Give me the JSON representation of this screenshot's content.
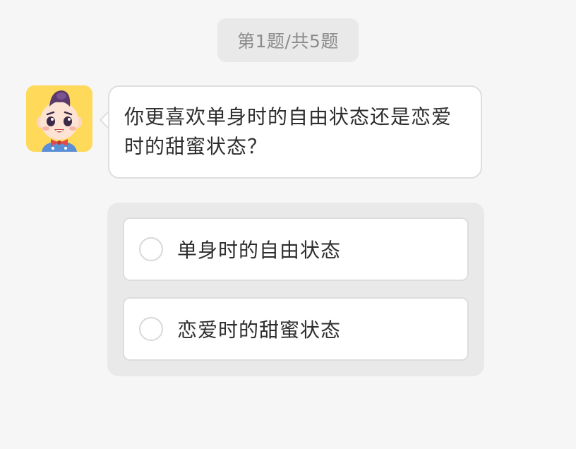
{
  "progress": {
    "text": "第1题/共5题",
    "current": 1,
    "total": 5
  },
  "question": {
    "text": "你更喜欢单身时的自由状态还是恋爱时的甜蜜状态？",
    "avatar_icon": "cartoon-boy-avatar"
  },
  "options": [
    {
      "label": "单身时的自由状态",
      "selected": false
    },
    {
      "label": "恋爱时的甜蜜状态",
      "selected": false
    }
  ],
  "colors": {
    "background": "#f6f6f6",
    "panel": "#e9e9e9",
    "card": "#ffffff",
    "avatar_bg": "#ffd95a",
    "text": "#2e2e2e",
    "muted_text": "#8c8c8c"
  }
}
